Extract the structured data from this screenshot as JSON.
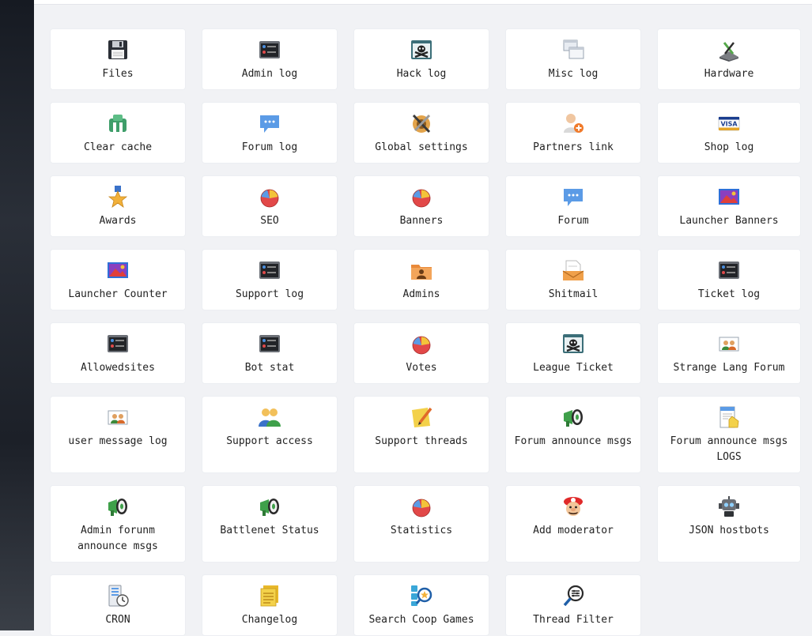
{
  "tiles": [
    {
      "label": "Files",
      "icon": "floppy-disk-icon"
    },
    {
      "label": "Admin log",
      "icon": "log-console-icon"
    },
    {
      "label": "Hack log",
      "icon": "skull-window-icon"
    },
    {
      "label": "Misc log",
      "icon": "windows-stack-icon"
    },
    {
      "label": "Hardware",
      "icon": "hardware-tools-icon"
    },
    {
      "label": "Clear cache",
      "icon": "cache-blocks-icon"
    },
    {
      "label": "Forum log",
      "icon": "chat-bubble-icon"
    },
    {
      "label": "Global settings",
      "icon": "wrench-settings-icon"
    },
    {
      "label": "Partners link",
      "icon": "user-add-icon"
    },
    {
      "label": "Shop log",
      "icon": "visa-card-icon"
    },
    {
      "label": "Awards",
      "icon": "star-medal-icon"
    },
    {
      "label": "SEO",
      "icon": "pie-chart-icon"
    },
    {
      "label": "Banners",
      "icon": "pie-chart-icon"
    },
    {
      "label": "Forum",
      "icon": "chat-bubble-icon"
    },
    {
      "label": "Launcher Banners",
      "icon": "picture-icon"
    },
    {
      "label": "Launcher Counter",
      "icon": "picture-icon"
    },
    {
      "label": "Support log",
      "icon": "log-console-icon"
    },
    {
      "label": "Admins",
      "icon": "user-folder-icon"
    },
    {
      "label": "Shitmail",
      "icon": "mail-folder-icon"
    },
    {
      "label": "Ticket log",
      "icon": "log-console-icon"
    },
    {
      "label": "Allowedsites",
      "icon": "log-console-icon"
    },
    {
      "label": "Bot stat",
      "icon": "log-console-icon"
    },
    {
      "label": "Votes",
      "icon": "pie-chart-icon"
    },
    {
      "label": "League Ticket",
      "icon": "skull-window-icon"
    },
    {
      "label": "Strange Lang Forum",
      "icon": "users-picture-icon"
    },
    {
      "label": "user message log",
      "icon": "users-picture-icon"
    },
    {
      "label": "Support access",
      "icon": "users-group-icon"
    },
    {
      "label": "Support threads",
      "icon": "note-pencil-icon"
    },
    {
      "label": "Forum announce msgs",
      "icon": "megaphone-icon"
    },
    {
      "label": "Forum announce msgs LOGS",
      "icon": "document-hand-icon"
    },
    {
      "label": "Admin forunm announce msgs",
      "icon": "megaphone-icon"
    },
    {
      "label": "Battlenet Status",
      "icon": "megaphone-icon"
    },
    {
      "label": "Statistics",
      "icon": "pie-chart-icon"
    },
    {
      "label": "Add moderator",
      "icon": "mario-face-icon"
    },
    {
      "label": "JSON hostbots",
      "icon": "robot-icon"
    },
    {
      "label": "CRON",
      "icon": "server-clock-icon"
    },
    {
      "label": "Changelog",
      "icon": "notes-stack-icon"
    },
    {
      "label": "Search Coop Games",
      "icon": "search-star-icon"
    },
    {
      "label": "Thread Filter",
      "icon": "filter-search-icon"
    }
  ],
  "colors": {
    "background": "#f1f2f5",
    "tile_background": "#ffffff",
    "text": "#222222"
  }
}
